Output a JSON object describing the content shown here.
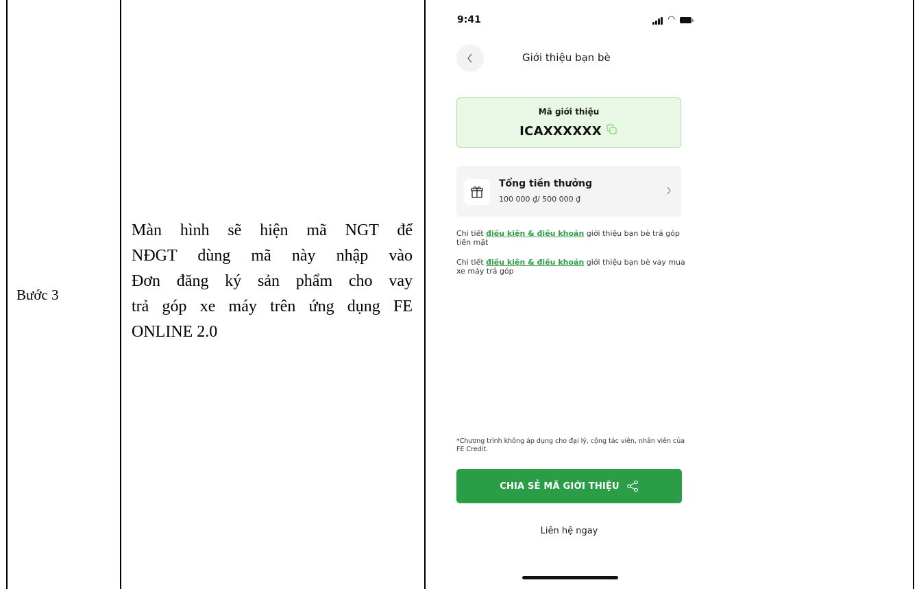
{
  "table": {
    "step_label": "Bước 3",
    "description_lines": [
      "Màn hình sẽ hiện mã NGT để",
      "NĐGT dùng mã này nhập vào",
      "Đơn đăng ký sản phẩm cho vay",
      "trả góp xe máy trên ứng dụng FE",
      "ONLINE 2.0"
    ]
  },
  "phone": {
    "status": {
      "time": "9:41",
      "icons": [
        "signal-icon",
        "wifi-icon",
        "battery-icon"
      ]
    },
    "nav": {
      "title": "Giới thiệu bạn bè",
      "back_icon": "chevron-left-icon"
    },
    "referral": {
      "label": "Mã giới thiệu",
      "code": "ICAXXXXXX",
      "copy_icon": "copy-icon"
    },
    "reward": {
      "title": "Tổng tiền thưởng",
      "amount_text": "100 000 ₫/ 500 000 ₫",
      "gift_icon": "gift-icon",
      "chevron_icon": "chevron-right-icon"
    },
    "terms": [
      {
        "prefix": "Chi tiết ",
        "link": "điều kiện & điều khoản",
        "suffix": " giới thiệu bạn bè trả góp tiền mặt"
      },
      {
        "prefix": "Chi tiết ",
        "link": "điều kiện & điều khoản",
        "suffix": " giới thiệu bạn bè vay mua xe máy trả góp"
      }
    ],
    "disclaimer": "*Chương trình không áp dụng cho đại lý, cộng tác viên, nhân viên của FE Credit.",
    "share_button": {
      "label": "CHIA SẺ MÃ GIỚI THIỆU",
      "icon": "share-icon"
    },
    "contact_link": "Liên hệ ngay",
    "colors": {
      "primary_green": "#2b9d47",
      "card_green_bg": "#e8f8e4",
      "card_green_border": "#b5dcaa",
      "link_green": "#2e9e48"
    }
  }
}
